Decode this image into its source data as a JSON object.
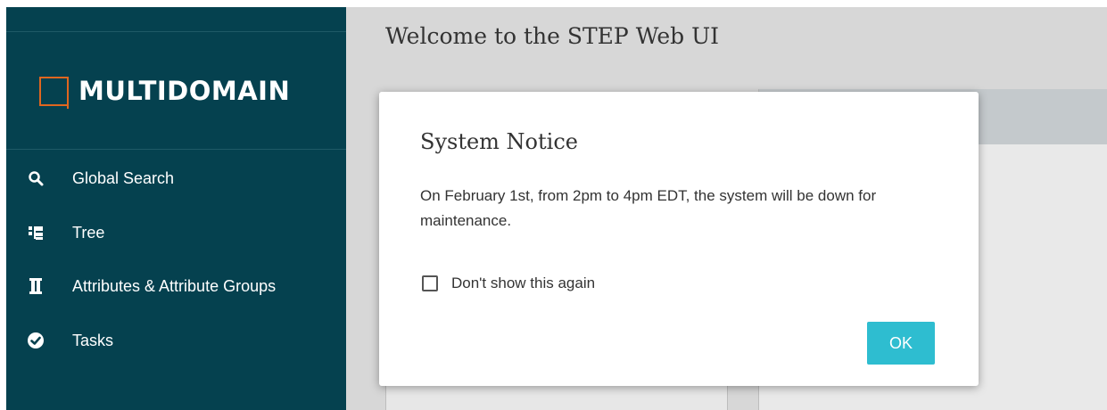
{
  "brand": {
    "name": "MULTIDOMAIN",
    "logo_color": "#e0661f"
  },
  "sidebar": {
    "background": "#05414f",
    "items": [
      {
        "label": "Global Search",
        "icon": "search-icon"
      },
      {
        "label": "Tree",
        "icon": "tree-icon"
      },
      {
        "label": "Attributes & Attribute Groups",
        "icon": "attributes-icon"
      },
      {
        "label": "Tasks",
        "icon": "check-circle-icon"
      }
    ]
  },
  "main": {
    "welcome_title": "Welcome to the STEP Web UI"
  },
  "modal": {
    "title": "System Notice",
    "message": "On February 1st, from 2pm to 4pm EDT, the system will be down for maintenance.",
    "checkbox_label": "Don't show this again",
    "checkbox_checked": false,
    "ok_label": "OK",
    "ok_color": "#2ebdd0"
  }
}
